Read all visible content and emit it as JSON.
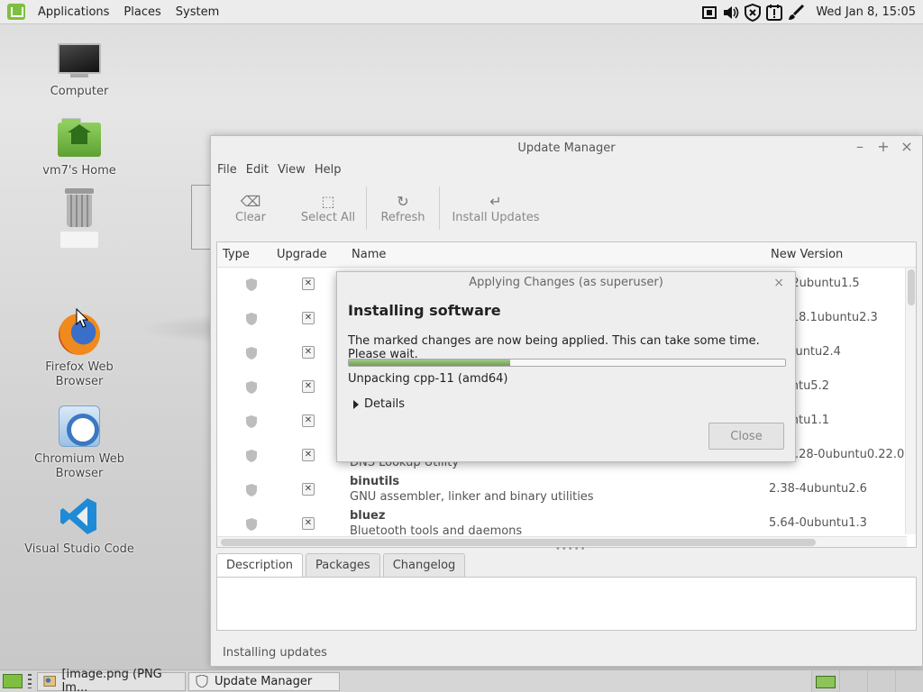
{
  "top_panel": {
    "menu": [
      "Applications",
      "Places",
      "System"
    ],
    "clock": "Wed Jan  8, 15:05"
  },
  "desktop": {
    "icons": [
      {
        "label": "Computer"
      },
      {
        "label": "vm7's Home"
      },
      {
        "label": ""
      },
      {
        "label": "Firefox Web Browser"
      },
      {
        "label": "Chromium Web\nBrowser"
      },
      {
        "label": "Visual Studio Code"
      }
    ]
  },
  "update_manager": {
    "title": "Update Manager",
    "menu": [
      "File",
      "Edit",
      "View",
      "Help"
    ],
    "toolbar": {
      "clear": "Clear",
      "select_all": "Select All",
      "refresh": "Refresh",
      "install": "Install Updates"
    },
    "columns": {
      "type": "Type",
      "upgrade": "Upgrade",
      "name": "Name",
      "new_version": "New Version"
    },
    "rows": [
      {
        "name": "",
        "desc": "",
        "version": "7.5-2ubuntu1.5"
      },
      {
        "name": "",
        "desc": "",
        "version": "91218.1ubuntu2.3"
      },
      {
        "name": "",
        "desc": "",
        "version": "-2ubuntu2.4"
      },
      {
        "name": "",
        "desc": "",
        "version": "ubuntu5.2"
      },
      {
        "name": "",
        "desc": "",
        "version": "ubuntu1.1"
      },
      {
        "name": "",
        "desc": "DNS Lookup Utility",
        "version": "9.18.28-0ubuntu0.22.0"
      },
      {
        "name": "binutils",
        "desc": "GNU assembler, linker and binary utilities",
        "version": "2.38-4ubuntu2.6"
      },
      {
        "name": "bluez",
        "desc": "Bluetooth tools and daemons",
        "version": "5.64-0ubuntu1.3"
      }
    ],
    "tabs": [
      "Description",
      "Packages",
      "Changelog"
    ],
    "status": "Installing updates"
  },
  "dialog": {
    "title": "Applying Changes (as superuser)",
    "heading": "Installing software",
    "message": "The marked changes are now being applied. This can take some time. Please wait.",
    "progress": 0.37,
    "status": "Unpacking cpp-11 (amd64)",
    "details": "Details",
    "close": "Close"
  },
  "taskbar": {
    "tasks": [
      "[image.png (PNG Im...",
      "Update Manager"
    ]
  }
}
